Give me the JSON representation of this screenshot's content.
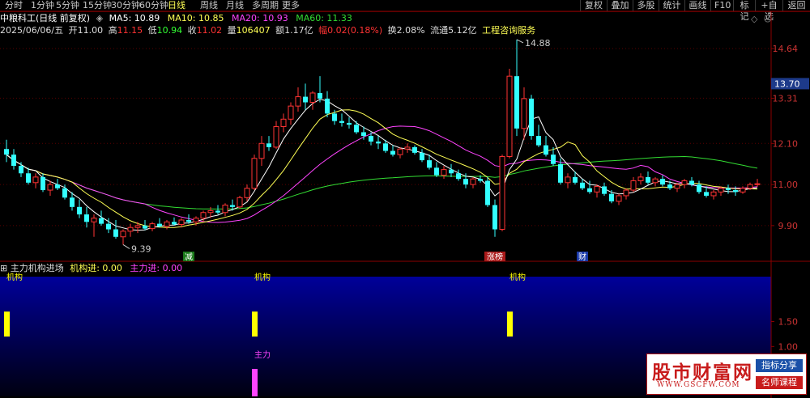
{
  "toolbar": {
    "periods": [
      "分时",
      "1分钟",
      "5分钟",
      "15分钟",
      "30分钟",
      "60分钟",
      "日线",
      "周线",
      "月线",
      "多周期",
      "更多"
    ],
    "active_period": "日线",
    "right_buttons": [
      "复权",
      "叠加",
      "多股",
      "统计",
      "画线",
      "F10",
      "标记",
      "+自选",
      "返回"
    ]
  },
  "header": {
    "stock_name": "中粮科工(日线 前复权)",
    "ma5_label": "MA5: 10.89",
    "ma10_label": "MA10: 10.85",
    "ma20_label": "MA20: 10.93",
    "ma60_label": "MA60: 11.33",
    "date": "2025/06/06/五",
    "open_label": "开",
    "open": "11.00",
    "high_label": "高",
    "high": "11.15",
    "low_label": "低",
    "low": "10.94",
    "close_label": "收",
    "close": "11.02",
    "volume_label": "量",
    "volume": "106407",
    "amount_label": "额",
    "amount": "1.17亿",
    "amplitude_label": "幅",
    "amplitude": "0.02(0.18%)",
    "turnover_label": "换",
    "turnover": "2.08%",
    "float_label": "流通",
    "float_value": "5.12亿",
    "concept": "工程咨询服务",
    "settings_icon": "diamond-icon",
    "close_icon": "circle-icon"
  },
  "colors": {
    "up": "#ff3333",
    "down": "#33ffff",
    "ma5": "#ffffff",
    "ma10": "#ffff55",
    "ma20": "#ff44ff",
    "ma60": "#33dd33",
    "indicator_bar_jigou": "#ffff00",
    "indicator_bar_zhuli": "#ff44ff",
    "indicator_bg_top": "#000099",
    "indicator_bg_bottom": "#000010"
  },
  "indicator": {
    "name": "主力机构进场",
    "jigou_label": "机构进: 0.00",
    "zhuli_label": "主力进: 0.00",
    "bar_label_jigou": "机构",
    "bar_label_zhuli": "主力"
  },
  "chart_data": [
    {
      "type": "candlestick",
      "y_axis_ticks": [
        "14.64",
        "13.31",
        "12.10",
        "11.00",
        "9.90"
      ],
      "current_price_tag": "13.70",
      "annotations": {
        "high": "14.88",
        "low": "9.39"
      },
      "event_markers": [
        "减",
        "涨榜",
        "财"
      ],
      "series": [
        {
          "name": "MA5",
          "value": "10.89"
        },
        {
          "name": "MA10",
          "value": "10.85"
        },
        {
          "name": "MA20",
          "value": "10.93"
        },
        {
          "name": "MA60",
          "value": "11.33"
        }
      ],
      "ylim": [
        9.4,
        14.9
      ],
      "candles": [
        [
          11.95,
          12.2,
          11.6,
          11.8
        ],
        [
          11.8,
          11.95,
          11.4,
          11.5
        ],
        [
          11.5,
          11.6,
          11.2,
          11.3
        ],
        [
          11.3,
          11.45,
          11.0,
          11.05
        ],
        [
          11.05,
          11.3,
          10.9,
          11.2
        ],
        [
          11.2,
          11.3,
          10.8,
          10.85
        ],
        [
          10.85,
          11.1,
          10.7,
          11.0
        ],
        [
          11.0,
          11.15,
          10.85,
          10.9
        ],
        [
          10.9,
          11.0,
          10.6,
          10.65
        ],
        [
          10.65,
          10.8,
          10.3,
          10.4
        ],
        [
          10.4,
          10.6,
          10.1,
          10.2
        ],
        [
          10.2,
          10.4,
          9.85,
          10.0
        ],
        [
          10.0,
          10.2,
          9.6,
          10.1
        ],
        [
          10.1,
          10.3,
          9.9,
          9.95
        ],
        [
          9.95,
          10.1,
          9.7,
          9.8
        ],
        [
          9.8,
          10.05,
          9.55,
          9.6
        ],
        [
          9.6,
          9.8,
          9.39,
          9.75
        ],
        [
          9.75,
          9.95,
          9.6,
          9.85
        ],
        [
          9.85,
          10.0,
          9.7,
          9.9
        ],
        [
          9.9,
          10.05,
          9.78,
          9.82
        ],
        [
          9.82,
          10.0,
          9.75,
          9.95
        ],
        [
          9.95,
          10.1,
          9.85,
          9.88
        ],
        [
          9.88,
          10.05,
          9.8,
          10.0
        ],
        [
          10.0,
          10.12,
          9.9,
          9.93
        ],
        [
          9.93,
          10.1,
          9.85,
          10.05
        ],
        [
          10.05,
          10.2,
          9.95,
          10.0
        ],
        [
          10.0,
          10.15,
          9.9,
          10.1
        ],
        [
          10.1,
          10.3,
          10.0,
          10.25
        ],
        [
          10.25,
          10.4,
          10.1,
          10.3
        ],
        [
          10.3,
          10.45,
          10.2,
          10.25
        ],
        [
          10.25,
          10.5,
          10.15,
          10.45
        ],
        [
          10.45,
          10.6,
          10.3,
          10.4
        ],
        [
          10.4,
          10.7,
          10.35,
          10.65
        ],
        [
          10.65,
          11.0,
          10.55,
          10.9
        ],
        [
          10.9,
          11.8,
          10.85,
          11.7
        ],
        [
          11.7,
          12.3,
          11.5,
          12.1
        ],
        [
          12.1,
          12.3,
          11.9,
          12.0
        ],
        [
          12.0,
          12.7,
          11.95,
          12.55
        ],
        [
          12.55,
          12.9,
          12.4,
          12.75
        ],
        [
          12.75,
          13.2,
          12.6,
          13.1
        ],
        [
          13.1,
          13.6,
          12.95,
          13.35
        ],
        [
          13.35,
          13.7,
          13.0,
          13.2
        ],
        [
          13.2,
          13.5,
          13.0,
          13.45
        ],
        [
          13.45,
          13.9,
          13.2,
          13.3
        ],
        [
          13.3,
          13.5,
          12.8,
          12.9
        ],
        [
          12.9,
          13.0,
          12.6,
          12.7
        ],
        [
          12.7,
          12.9,
          12.55,
          12.65
        ],
        [
          12.65,
          12.8,
          12.5,
          12.6
        ],
        [
          12.6,
          12.7,
          12.35,
          12.4
        ],
        [
          12.4,
          12.55,
          12.2,
          12.3
        ],
        [
          12.3,
          12.4,
          12.05,
          12.15
        ],
        [
          12.15,
          12.3,
          11.95,
          12.1
        ],
        [
          12.1,
          12.2,
          11.85,
          11.9
        ],
        [
          11.9,
          12.05,
          11.75,
          11.8
        ],
        [
          11.8,
          12.0,
          11.7,
          11.95
        ],
        [
          11.95,
          12.1,
          11.85,
          12.0
        ],
        [
          12.0,
          12.05,
          11.8,
          11.85
        ],
        [
          11.85,
          11.95,
          11.6,
          11.65
        ],
        [
          11.65,
          11.8,
          11.4,
          11.45
        ],
        [
          11.45,
          11.6,
          11.2,
          11.25
        ],
        [
          11.25,
          11.5,
          11.15,
          11.4
        ],
        [
          11.4,
          11.55,
          11.2,
          11.3
        ],
        [
          11.3,
          11.4,
          11.1,
          11.15
        ],
        [
          11.15,
          11.3,
          10.9,
          11.0
        ],
        [
          11.0,
          11.2,
          10.9,
          11.15
        ],
        [
          11.15,
          11.25,
          11.05,
          11.1
        ],
        [
          11.1,
          11.2,
          10.4,
          10.45
        ],
        [
          10.45,
          10.6,
          9.6,
          9.8
        ],
        [
          9.8,
          11.8,
          9.75,
          11.75
        ],
        [
          11.75,
          14.1,
          11.7,
          13.9
        ],
        [
          13.9,
          14.88,
          12.3,
          12.5
        ],
        [
          12.5,
          13.6,
          12.2,
          13.3
        ],
        [
          13.3,
          13.4,
          12.2,
          12.3
        ],
        [
          12.3,
          12.6,
          12.0,
          12.05
        ],
        [
          12.05,
          12.3,
          11.75,
          11.8
        ],
        [
          11.8,
          12.0,
          11.5,
          11.55
        ],
        [
          11.55,
          11.7,
          11.0,
          11.05
        ],
        [
          11.05,
          11.3,
          10.9,
          11.2
        ],
        [
          11.2,
          11.35,
          11.0,
          11.05
        ],
        [
          11.05,
          11.15,
          10.85,
          10.9
        ],
        [
          10.9,
          11.1,
          10.75,
          10.8
        ],
        [
          10.8,
          11.0,
          10.65,
          10.95
        ],
        [
          10.95,
          11.05,
          10.7,
          10.75
        ],
        [
          10.75,
          10.85,
          10.5,
          10.55
        ],
        [
          10.55,
          10.75,
          10.45,
          10.7
        ],
        [
          10.7,
          10.9,
          10.6,
          10.85
        ],
        [
          10.85,
          11.2,
          10.8,
          11.1
        ],
        [
          11.1,
          11.3,
          11.0,
          11.2
        ],
        [
          11.2,
          11.35,
          11.0,
          11.05
        ],
        [
          11.05,
          11.2,
          10.95,
          11.15
        ],
        [
          11.15,
          11.25,
          10.95,
          11.0
        ],
        [
          11.0,
          11.1,
          10.85,
          10.9
        ],
        [
          10.9,
          11.05,
          10.8,
          11.0
        ],
        [
          11.0,
          11.15,
          10.9,
          11.1
        ],
        [
          11.1,
          11.2,
          10.95,
          11.0
        ],
        [
          11.0,
          11.1,
          10.75,
          10.8
        ],
        [
          10.8,
          10.95,
          10.65,
          10.7
        ],
        [
          10.7,
          10.85,
          10.6,
          10.8
        ],
        [
          10.8,
          10.95,
          10.7,
          10.9
        ],
        [
          10.9,
          11.0,
          10.75,
          10.85
        ],
        [
          10.85,
          10.95,
          10.7,
          10.8
        ],
        [
          10.8,
          10.95,
          10.75,
          10.9
        ],
        [
          10.9,
          11.05,
          10.85,
          11.0
        ],
        [
          11.0,
          11.15,
          10.94,
          11.02
        ]
      ]
    },
    {
      "type": "bar",
      "name": "主力机构进场",
      "y_axis_ticks": [
        "1.50",
        "1.00"
      ],
      "ylim": [
        0,
        2.4
      ],
      "series": [
        {
          "name": "机构进",
          "bars": [
            [
              0,
              1.7
            ],
            [
              34,
              1.7
            ],
            [
              69,
              1.7
            ]
          ]
        },
        {
          "name": "主力进",
          "bars": [
            [
              34,
              0.55
            ]
          ]
        }
      ]
    }
  ]
}
